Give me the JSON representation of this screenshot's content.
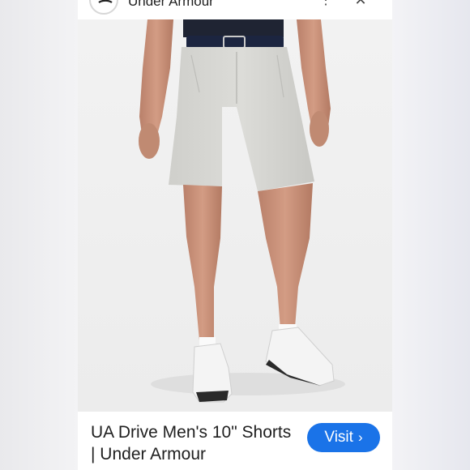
{
  "source": {
    "name": "Under Armour",
    "logo_icon": "under-armour-logo-icon"
  },
  "topbar": {
    "more_icon": "more-vert-icon",
    "close_icon": "close-icon"
  },
  "product": {
    "image_icon": "product-photo",
    "title": "UA Drive Men's 10\" Shorts | Under Armour"
  },
  "actions": {
    "visit_label": "Visit",
    "visit_icon": "chevron-right-icon"
  },
  "colors": {
    "accent": "#1a73e8",
    "background": "#ffffff",
    "text": "#1f1f1f"
  }
}
